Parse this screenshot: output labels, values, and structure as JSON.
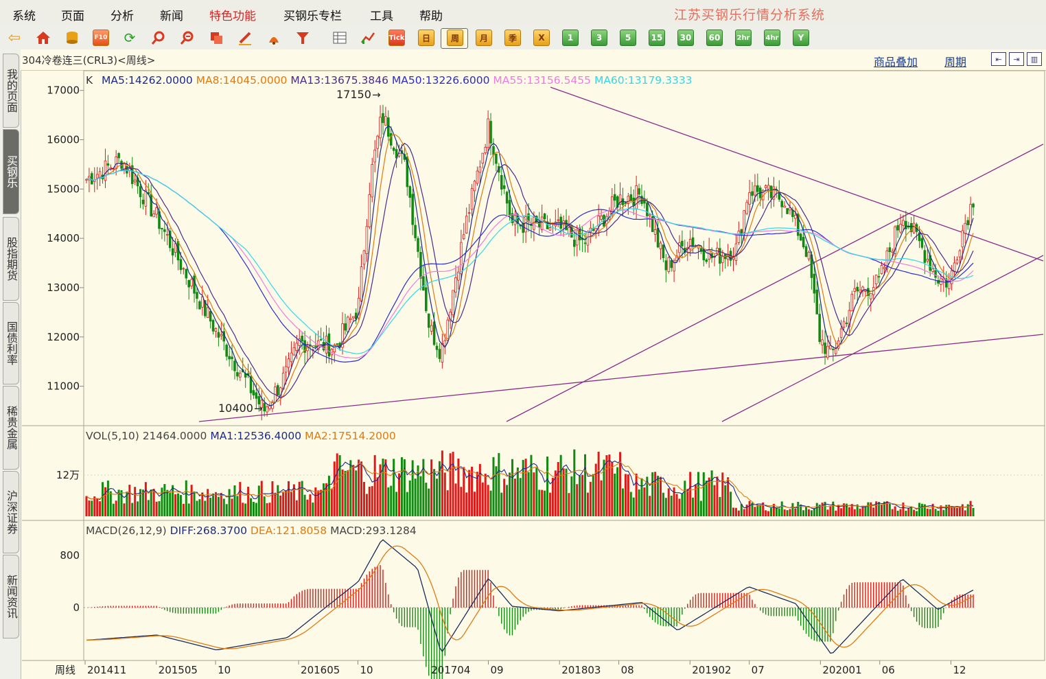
{
  "menu": {
    "items": [
      "系统",
      "页面",
      "分析",
      "新闻",
      "特色功能",
      "买钢乐专栏",
      "工具",
      "帮助"
    ],
    "highlight_index": 4,
    "highlight_color": "#e02020"
  },
  "app_title": "江苏买钢乐行情分析系统",
  "toolbar": {
    "icons": [
      "back-arrow-icon",
      "home-icon",
      "database-icon",
      "f10-icon",
      "refresh-icon",
      "zoom-in-icon",
      "zoom-out-icon",
      "window-icon",
      "pencil-icon",
      "alarm-icon",
      "filter-icon",
      "table-icon",
      "trend-icon",
      "tick-icon"
    ],
    "tick_label": "Tick",
    "periods": [
      "日",
      "周",
      "月",
      "季",
      "X",
      "1",
      "3",
      "5",
      "15",
      "30",
      "60",
      "2hr",
      "4hr",
      "Y"
    ],
    "active_period": "周"
  },
  "sidebar": {
    "tabs": [
      "我的页面",
      "买钢乐",
      "股指期货",
      "国债利率",
      "稀贵金属",
      "沪深证券",
      "新闻资讯"
    ],
    "active_index": 1
  },
  "header": {
    "instrument": "304冷卷连三(CRL3)<周线>",
    "overlay_link": "商品叠加",
    "period_link": "周期"
  },
  "price_panel": {
    "prefix": "K",
    "legend": [
      {
        "label": "MA5:14262.0000",
        "color": "#1a2a8c"
      },
      {
        "label": "MA8:14045.0000",
        "color": "#e07a10"
      },
      {
        "label": "MA13:13675.3846",
        "color": "#4a2a8a"
      },
      {
        "label": "MA50:13226.6000",
        "color": "#2a2ad0"
      },
      {
        "label": "MA55:13156.5455",
        "color": "#f07ae0"
      },
      {
        "label": "MA60:13179.3333",
        "color": "#30d8e8"
      }
    ],
    "yticks": [
      "17000",
      "16000",
      "15000",
      "14000",
      "13000",
      "12000",
      "11000"
    ],
    "high_annotation": "17150",
    "low_annotation": "10400"
  },
  "volume_panel": {
    "legend": [
      {
        "label": "VOL(5,10) 21464.0000",
        "color": "#444444"
      },
      {
        "label": "MA1:12536.4000",
        "color": "#1a2a8c"
      },
      {
        "label": "MA2:17514.2000",
        "color": "#e07a10"
      }
    ],
    "ytick": "12万"
  },
  "macd_panel": {
    "legend": [
      {
        "label": "MACD(26,12,9)",
        "color": "#444444"
      },
      {
        "label": "DIFF:268.3700",
        "color": "#1a2a8c"
      },
      {
        "label": "DEA:121.8058",
        "color": "#e07a10"
      },
      {
        "label": "MACD:293.1284",
        "color": "#444444"
      }
    ],
    "yticks": [
      "800",
      "0"
    ]
  },
  "time_axis": {
    "label": "周线",
    "ticks": [
      "201411",
      "201505",
      "10",
      "201605",
      "10",
      "201704",
      "09",
      "201803",
      "08",
      "201902",
      "07",
      "202001",
      "06",
      "12"
    ]
  },
  "colors": {
    "up": "#e01818",
    "down": "#108a10",
    "trendline": "#8a2a8a",
    "background": "#fdfbe8"
  },
  "chart_data": {
    "type": "candlestick",
    "period": "weekly",
    "instrument": "304冷卷连三(CRL3)",
    "ylim": [
      10200,
      17400
    ],
    "anchors_close": [
      [
        "201411",
        15200
      ],
      [
        "201502",
        15600
      ],
      [
        "201505",
        14400
      ],
      [
        "201508",
        13000
      ],
      [
        "201510",
        12100
      ],
      [
        "201602",
        10500
      ],
      [
        "201604",
        11300
      ],
      [
        "201605",
        11900
      ],
      [
        "201608",
        11800
      ],
      [
        "201610",
        12600
      ],
      [
        "201611",
        15200
      ],
      [
        "201612",
        16500
      ],
      [
        "201702",
        15400
      ],
      [
        "201704",
        12200
      ],
      [
        "201705",
        11700
      ],
      [
        "201707",
        14200
      ],
      [
        "201709",
        16300
      ],
      [
        "201711",
        14300
      ],
      [
        "201803",
        14200
      ],
      [
        "201805",
        13900
      ],
      [
        "201808",
        14800
      ],
      [
        "201810",
        14900
      ],
      [
        "201812",
        13400
      ],
      [
        "201902",
        14000
      ],
      [
        "201904",
        13600
      ],
      [
        "201906",
        13800
      ],
      [
        "201907",
        15000
      ],
      [
        "201910",
        14800
      ],
      [
        "201912",
        13700
      ],
      [
        "202001",
        12000
      ],
      [
        "202002",
        11600
      ],
      [
        "202004",
        12900
      ],
      [
        "202006",
        13100
      ],
      [
        "202008",
        14500
      ],
      [
        "202009",
        14100
      ],
      [
        "202011",
        13200
      ],
      [
        "202012",
        13100
      ],
      [
        "202101",
        14100
      ],
      [
        "202102",
        14800
      ]
    ],
    "volume_ytick": 120000,
    "macd_anchors": [
      [
        "201411",
        -500
      ],
      [
        "201505",
        -420
      ],
      [
        "201510",
        -650
      ],
      [
        "201604",
        -460
      ],
      [
        "201610",
        400
      ],
      [
        "201612",
        1050
      ],
      [
        "201703",
        600
      ],
      [
        "201705",
        -700
      ],
      [
        "201709",
        450
      ],
      [
        "201711",
        20
      ],
      [
        "201803",
        -50
      ],
      [
        "201810",
        80
      ],
      [
        "201901",
        -350
      ],
      [
        "201907",
        320
      ],
      [
        "201911",
        60
      ],
      [
        "202002",
        -720
      ],
      [
        "202008",
        440
      ],
      [
        "202011",
        -30
      ],
      [
        "202102",
        270
      ]
    ]
  }
}
